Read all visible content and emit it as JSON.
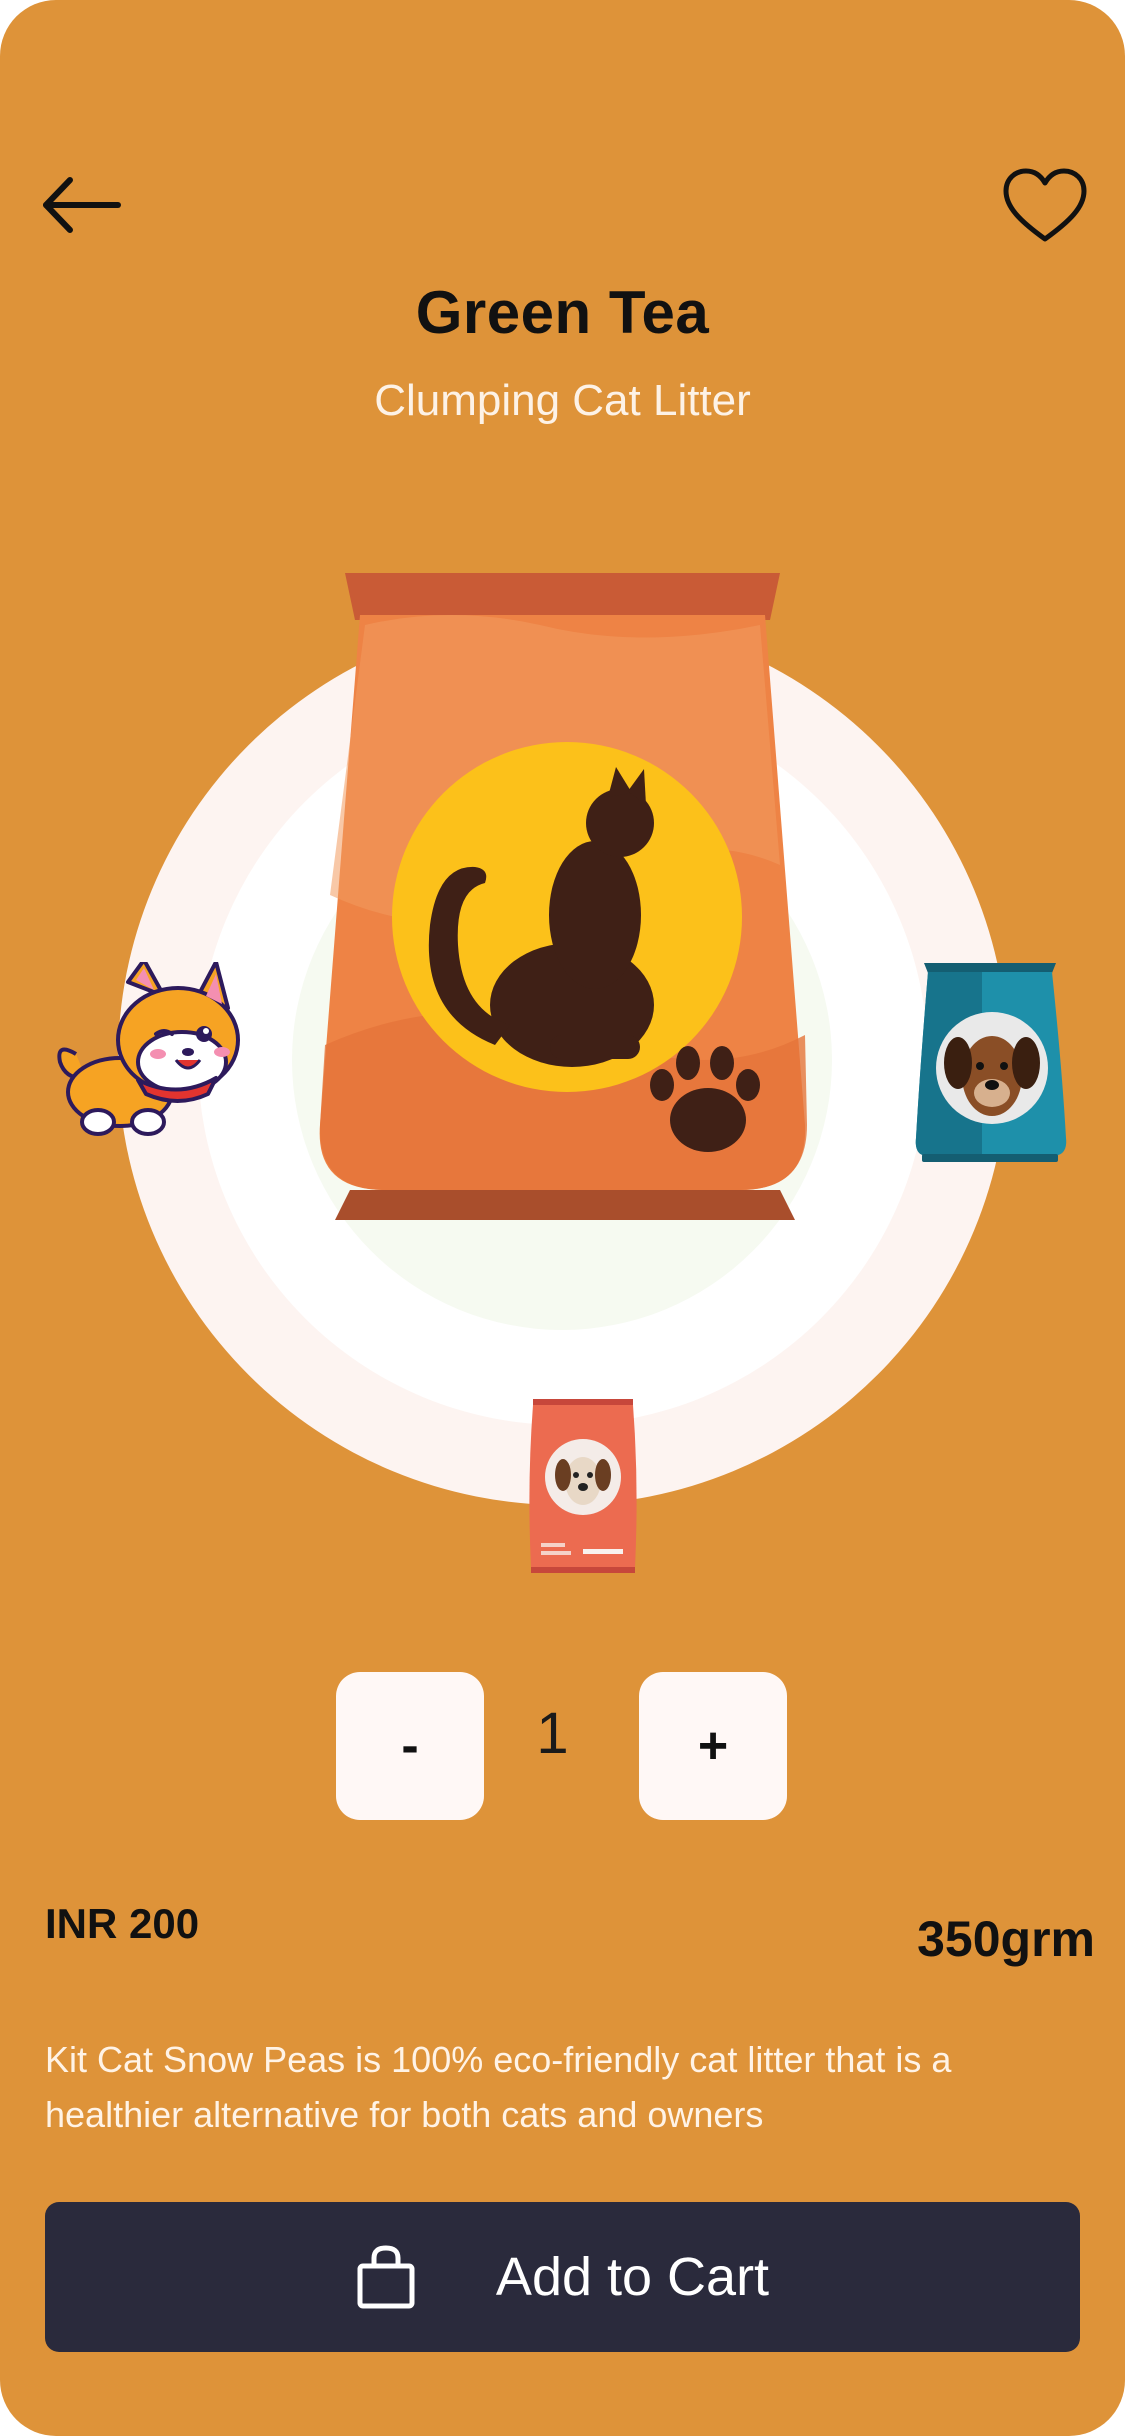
{
  "header": {
    "back_icon": "arrow-left-icon",
    "favorite_icon": "heart-outline-icon"
  },
  "product": {
    "title": "Green Tea",
    "subtitle": "Clumping Cat Litter",
    "price": "INR 200",
    "weight": "350grm",
    "description": "Kit Cat Snow Peas is 100% eco-friendly cat litter that is a healthier alternative for both cats and owners"
  },
  "quantity": {
    "minus_label": "-",
    "value": "1",
    "plus_label": "+"
  },
  "cart": {
    "label": "Add to Cart",
    "icon": "shopping-bag-icon"
  },
  "colors": {
    "background": "#DE9339",
    "button_dark": "#2A2A3C",
    "bag_orange": "#EE8345",
    "cat_circle": "#FCC11A",
    "teal_bag": "#1E90AA"
  }
}
